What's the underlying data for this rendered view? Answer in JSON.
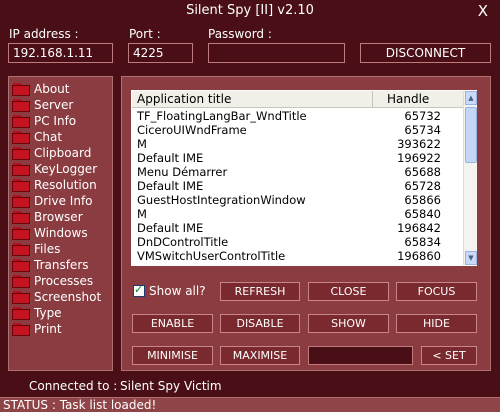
{
  "window": {
    "title": "Silent Spy [II] v2.10",
    "close_glyph": "X"
  },
  "connection": {
    "ip_label": "IP address :",
    "ip_value": "192.168.1.11",
    "port_label": "Port :",
    "port_value": "4225",
    "password_label": "Password :",
    "password_value": "",
    "disconnect_label": "DISCONNECT"
  },
  "sidebar": {
    "items": [
      {
        "label": "About"
      },
      {
        "label": "Server"
      },
      {
        "label": "PC Info"
      },
      {
        "label": "Chat"
      },
      {
        "label": "Clipboard"
      },
      {
        "label": "KeyLogger"
      },
      {
        "label": "Resolution"
      },
      {
        "label": "Drive Info"
      },
      {
        "label": "Browser"
      },
      {
        "label": "Windows"
      },
      {
        "label": "Files"
      },
      {
        "label": "Transfers"
      },
      {
        "label": "Processes"
      },
      {
        "label": "Screenshot"
      },
      {
        "label": "Type"
      },
      {
        "label": "Print"
      }
    ]
  },
  "task_list": {
    "columns": [
      "Application title",
      "Handle"
    ],
    "rows": [
      [
        "TF_FloatingLangBar_WndTitle",
        "65732"
      ],
      [
        "CiceroUIWndFrame",
        "65734"
      ],
      [
        "M",
        "393622"
      ],
      [
        "Default IME",
        "196922"
      ],
      [
        "Menu Démarrer",
        "65688"
      ],
      [
        "Default IME",
        "65728"
      ],
      [
        "GuestHostIntegrationWindow",
        "65866"
      ],
      [
        "M",
        "65840"
      ],
      [
        "Default IME",
        "196842"
      ],
      [
        "DnDControlTitle",
        "65834"
      ],
      [
        "VMSwitchUserControlTitle",
        "196860"
      ],
      [
        "",
        ""
      ]
    ]
  },
  "controls": {
    "show_all_label": "Show all?",
    "show_all_checked": true,
    "refresh": "REFRESH",
    "close": "CLOSE",
    "focus": "FOCUS",
    "enable": "ENABLE",
    "disable": "DISABLE",
    "show": "SHOW",
    "hide": "HIDE",
    "minimise": "MINIMISE",
    "maximise": "MAXIMISE",
    "set_value": "",
    "set": "< SET"
  },
  "footer": {
    "connected_label": "Connected to :",
    "connected_value": "Silent Spy Victim",
    "status_text": "STATUS : Task list loaded!"
  },
  "icons": {
    "sidebar_item": "folder-icon",
    "checkbox_mark": "checkmark-icon"
  },
  "colors": {
    "background": "#4a0f16",
    "panel": "#8a3c40",
    "button": "#7a2a2e",
    "border": "#c07a7e"
  }
}
